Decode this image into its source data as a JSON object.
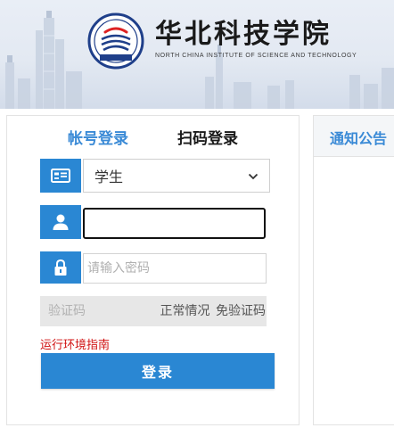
{
  "header": {
    "school_name": "华北科技学院",
    "school_name_en": "NORTH CHINA INSTITUTE OF SCIENCE AND TECHNOLOGY",
    "seal_text": "华北科技学院"
  },
  "login": {
    "tabs": {
      "account": "帐号登录",
      "qrcode": "扫码登录"
    },
    "role_select": {
      "selected": "学生",
      "icon": "id-card-icon"
    },
    "username": {
      "value": "",
      "placeholder": "",
      "icon": "user-icon"
    },
    "password": {
      "value": "",
      "placeholder": "请输入密码",
      "icon": "lock-icon"
    },
    "captcha": {
      "placeholder": "验证码",
      "status": "正常情况 免验证码"
    },
    "guide_link": "运行环境指南",
    "submit_label": "登录"
  },
  "notice": {
    "title": "通知公告"
  },
  "colors": {
    "primary": "#2a87d3",
    "tab_active": "#3a8ad6",
    "link_red": "#d01010",
    "captcha_bg": "#e7e7e7"
  }
}
